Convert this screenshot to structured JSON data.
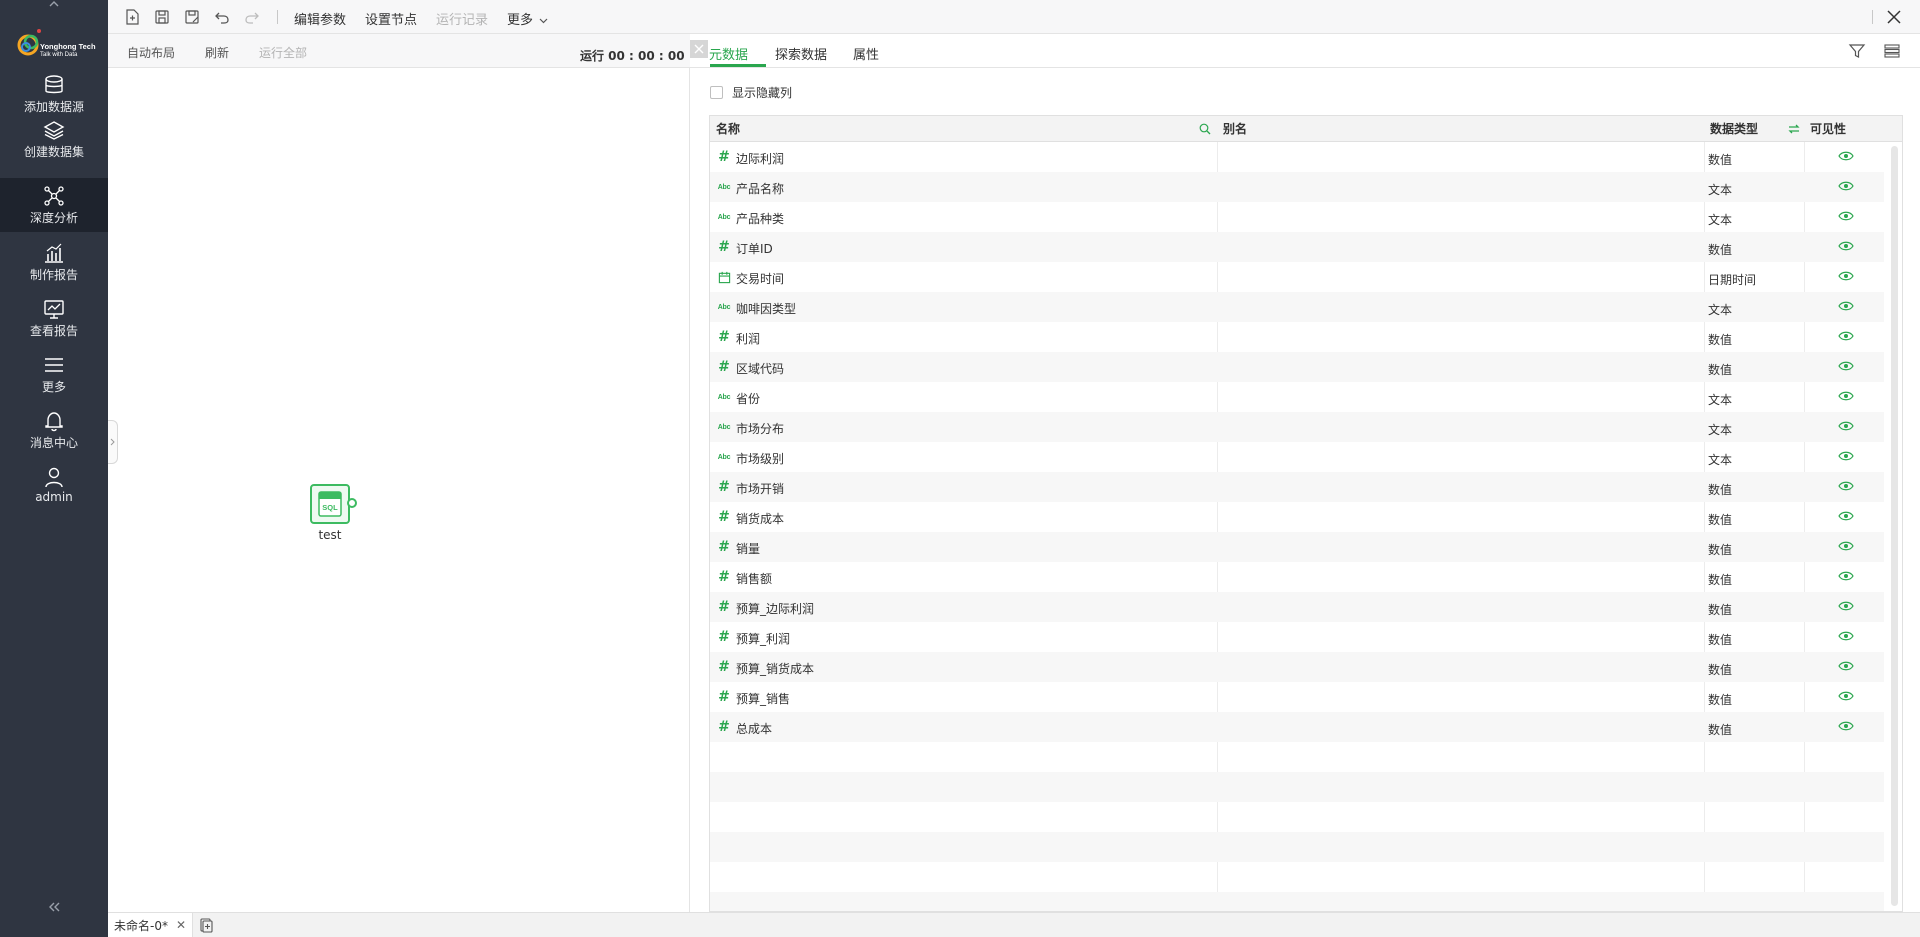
{
  "brand": {
    "name": "Yonghong Tech",
    "tagline": "Talk with Data"
  },
  "sidebar": {
    "items": [
      {
        "label": "添加数据源",
        "icon": "database-icon"
      },
      {
        "label": "创建数据集",
        "icon": "layers-icon"
      },
      {
        "label": "深度分析",
        "icon": "network-icon",
        "active": true
      },
      {
        "label": "制作报告",
        "icon": "chart-report-icon"
      },
      {
        "label": "查看报告",
        "icon": "monitor-chart-icon"
      },
      {
        "label": "更多",
        "icon": "menu-icon"
      },
      {
        "label": "消息中心",
        "icon": "bell-icon"
      },
      {
        "label": "admin",
        "icon": "user-icon"
      }
    ]
  },
  "toolbar": {
    "edit_params": "编辑参数",
    "set_node": "设置节点",
    "run_log": "运行记录",
    "more": "更多"
  },
  "canvas": {
    "auto_layout": "自动布局",
    "refresh": "刷新",
    "run_all": "运行全部",
    "run_timer": "运行 00 : 00 : 00",
    "node": {
      "label": "test",
      "badge": "SQL"
    }
  },
  "panel": {
    "tabs": [
      "元数据",
      "探索数据",
      "属性"
    ],
    "show_hidden_label": "显示隐藏列",
    "columns": {
      "name": "名称",
      "alias": "别名",
      "type": "数据类型",
      "visibility": "可见性"
    },
    "rows": [
      {
        "kind": "num",
        "name": "边际利润",
        "type": "数值"
      },
      {
        "kind": "abc",
        "name": "产品名称",
        "type": "文本"
      },
      {
        "kind": "abc",
        "name": "产品种类",
        "type": "文本"
      },
      {
        "kind": "num",
        "name": "订单ID",
        "type": "数值"
      },
      {
        "kind": "date",
        "name": "交易时间",
        "type": "日期时间"
      },
      {
        "kind": "abc",
        "name": "咖啡因类型",
        "type": "文本"
      },
      {
        "kind": "num",
        "name": "利润",
        "type": "数值"
      },
      {
        "kind": "num",
        "name": "区域代码",
        "type": "数值"
      },
      {
        "kind": "abc",
        "name": "省份",
        "type": "文本"
      },
      {
        "kind": "abc",
        "name": "市场分布",
        "type": "文本"
      },
      {
        "kind": "abc",
        "name": "市场级别",
        "type": "文本"
      },
      {
        "kind": "num",
        "name": "市场开销",
        "type": "数值"
      },
      {
        "kind": "num",
        "name": "销货成本",
        "type": "数值"
      },
      {
        "kind": "num",
        "name": "销量",
        "type": "数值"
      },
      {
        "kind": "num",
        "name": "销售额",
        "type": "数值"
      },
      {
        "kind": "num",
        "name": "预算_边际利润",
        "type": "数值"
      },
      {
        "kind": "num",
        "name": "预算_利润",
        "type": "数值"
      },
      {
        "kind": "num",
        "name": "预算_销货成本",
        "type": "数值"
      },
      {
        "kind": "num",
        "name": "预算_销售",
        "type": "数值"
      },
      {
        "kind": "num",
        "name": "总成本",
        "type": "数值"
      }
    ]
  },
  "bottom": {
    "doc_tab": "未命名-0*"
  },
  "colors": {
    "accent": "#2aa64e",
    "sidebar_bg": "#2f3541",
    "search_highlight": "#e04545"
  }
}
